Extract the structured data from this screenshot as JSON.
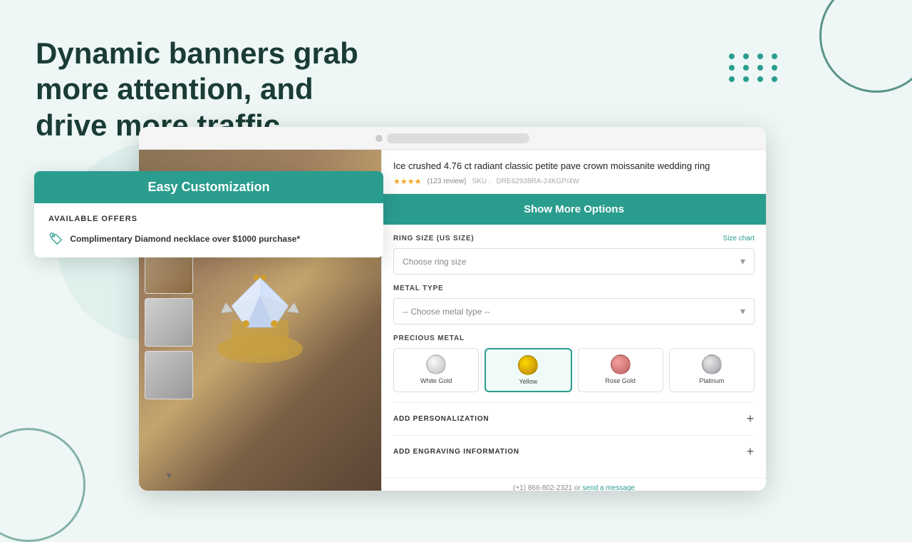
{
  "page": {
    "background_color": "#eef7f5"
  },
  "hero": {
    "title_line1": "Dynamic banners grab more attention, and",
    "title_line2": "drive more traffic."
  },
  "browser": {
    "product": {
      "title": "Ice crushed 4.76 ct radiant classic petite pave crown moissanite wedding ring",
      "sku_label": "SKU :",
      "sku": "DRE62938RA-24KGP/4W",
      "stars": "★★★★",
      "review_count": "(123 review)"
    },
    "show_more_button": "Show More Options",
    "ring_size": {
      "label": "RING SIZE (US SIZE)",
      "size_chart": "Size chart",
      "placeholder": "Choose ring size"
    },
    "metal_type": {
      "label": "METAL TYPE",
      "placeholder": "-- Choose metal type --"
    },
    "precious_metal": {
      "label": "PRECIOUS METAL",
      "options": [
        {
          "name": "White Gold",
          "type": "white"
        },
        {
          "name": "Yellow",
          "type": "yellow",
          "selected": true
        },
        {
          "name": "Rose Gold",
          "type": "rose"
        },
        {
          "name": "Platinum",
          "type": "platinum"
        }
      ]
    },
    "add_personalization": "ADD PERSONALIZATION",
    "add_engraving": "ADD ENGRAVING INFORMATION",
    "contact": {
      "phone": "(+1) 866-802-2321",
      "or_text": "or",
      "send_message": "send a message"
    }
  },
  "overlay_card": {
    "header": "Easy Customization",
    "available_offers_label": "AVAILABLE OFFERS",
    "offer_text": "Complimentary Diamond necklace over $1000 purchase*"
  }
}
